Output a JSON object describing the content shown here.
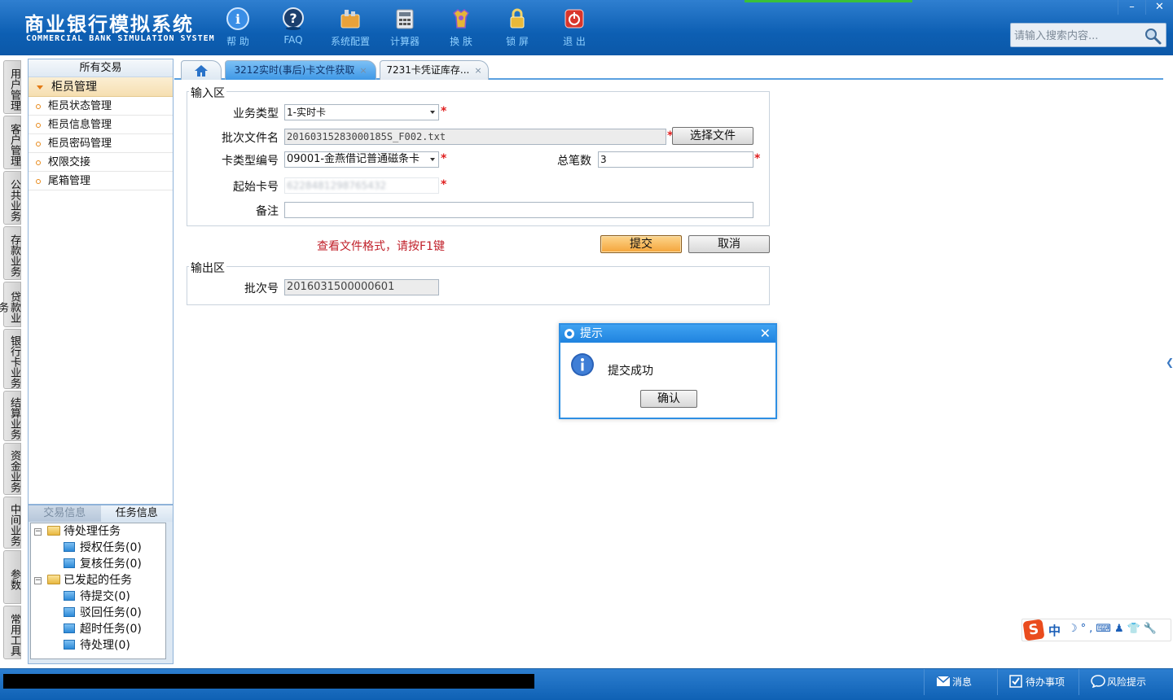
{
  "header": {
    "brand_cn": "商业银行模拟系统",
    "brand_en": "COMMERCIAL BANK SIMULATION SYSTEM",
    "toolbar": [
      {
        "label": "帮 助",
        "icon": "help-icon"
      },
      {
        "label": "FAQ",
        "icon": "faq-icon"
      },
      {
        "label": "系统配置",
        "icon": "system-config-icon"
      },
      {
        "label": "计算器",
        "icon": "calculator-icon"
      },
      {
        "label": "换 肤",
        "icon": "skin-icon"
      },
      {
        "label": "锁 屏",
        "icon": "lock-icon"
      },
      {
        "label": "退 出",
        "icon": "exit-icon"
      }
    ],
    "minimize": "–",
    "close": "✕",
    "search_placeholder": "请输入搜索内容..."
  },
  "vnav": [
    "用户管理",
    "客户管理",
    "公共业务",
    "存款业务",
    "贷款业务",
    "银行卡业务",
    "结算业务",
    "资金业务",
    "中间业务",
    "参数",
    "常用工具"
  ],
  "sidebar": {
    "title": "所有交易",
    "group": "柜员管理",
    "items": [
      "柜员状态管理",
      "柜员信息管理",
      "柜员密码管理",
      "权限交接",
      "尾箱管理"
    ]
  },
  "taskpanel": {
    "tabs": [
      "交易信息",
      "任务信息"
    ],
    "tree": {
      "pending": "待处理任务",
      "auth": "授权任务(0)",
      "review": "复核任务(0)",
      "initiated": "已发起的任务",
      "to_submit": "待提交(0)",
      "rejected": "驳回任务(0)",
      "timeout": "超时任务(0)",
      "to_process": "待处理(0)"
    }
  },
  "tabs": {
    "active": "3212实时(事后)卡文件获取",
    "other": "7231卡凭证库存...",
    "close": "×"
  },
  "form": {
    "input_legend": "输入区",
    "business_type_label": "业务类型",
    "business_type_value": "1-实时卡",
    "batch_file_label": "批次文件名",
    "batch_file_value": "20160315283000185S_F002.txt",
    "choose_file": "选择文件",
    "card_type_label": "卡类型编号",
    "card_type_value": "09001-金燕借记普通磁条卡",
    "total_label": "总笔数",
    "total_value": "3",
    "start_card_label": "起始卡号",
    "start_card_value": "6228481298765432",
    "remark_label": "备注",
    "remark_value": "",
    "required_mark": "*",
    "hint": "查看文件格式，请按F1键",
    "submit": "提交",
    "cancel": "取消",
    "output_legend": "输出区",
    "batch_no_label": "批次号",
    "batch_no_value": "2016031500000601"
  },
  "dialog": {
    "title": "提示",
    "message": "提交成功",
    "ok": "确认",
    "close": "✕"
  },
  "ime": {
    "logo": "S",
    "mode": "中",
    "icons": "☽°,⌨♟👕🔧"
  },
  "status": {
    "messages": "消息",
    "todo": "待办事项",
    "risk": "风险提示"
  }
}
